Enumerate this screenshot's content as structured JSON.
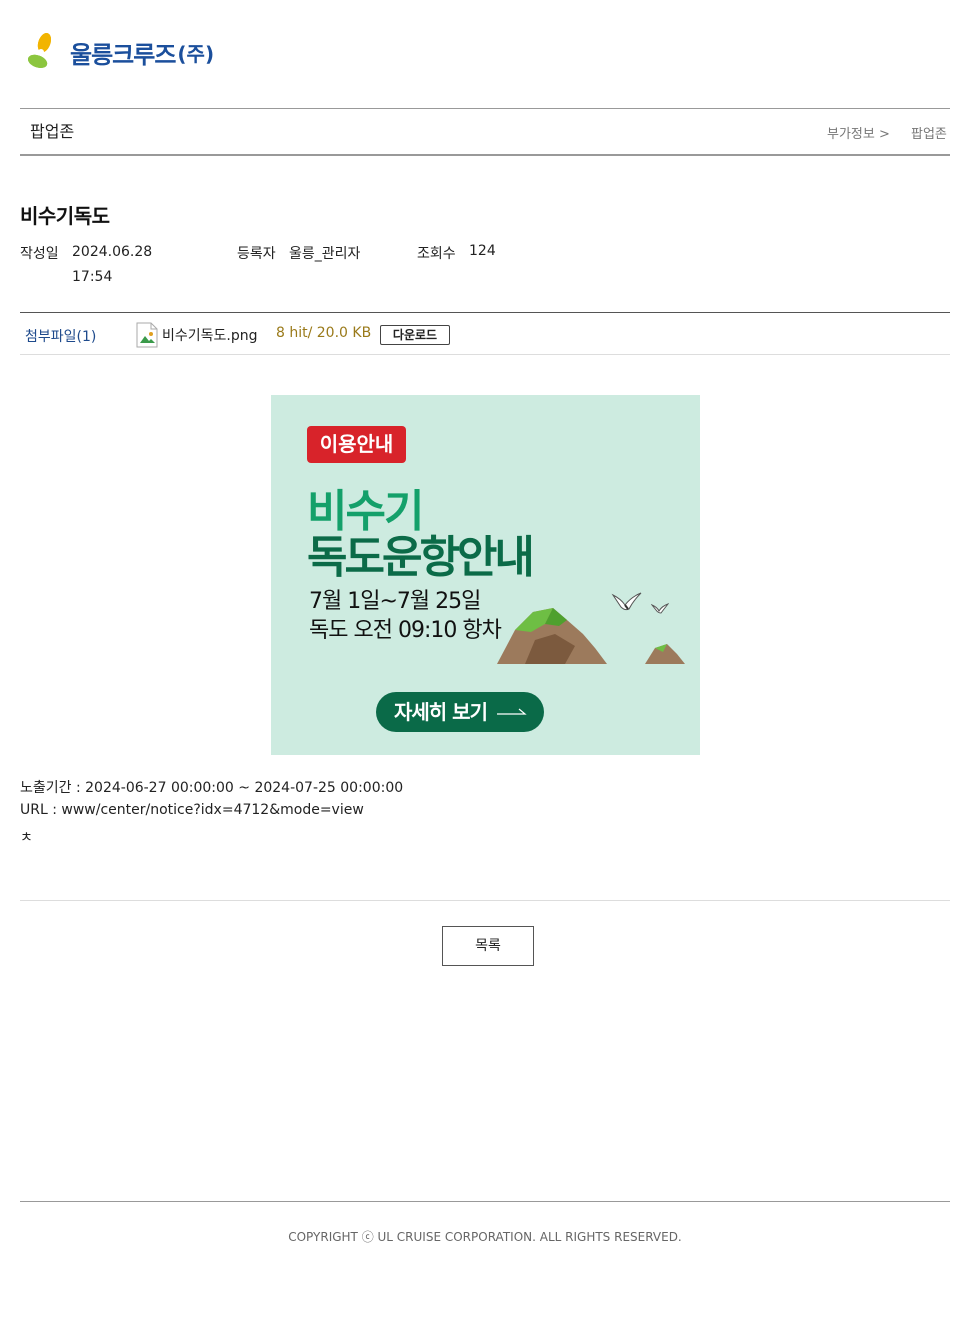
{
  "header": {
    "brand": "울릉크루즈",
    "brand_suffix": "(주)"
  },
  "topbar": {
    "title": "팝업존",
    "breadcrumb": [
      "부가정보 >",
      "팝업존"
    ]
  },
  "post": {
    "title": "비수기독도",
    "meta": {
      "date_label": "작성일",
      "date_value": "2024.06.28",
      "time_value": "17:54",
      "author_label": "등록자",
      "author_value": "울릉_관리자",
      "views_label": "조회수",
      "views_value": "124"
    },
    "attachments": {
      "label": "첨부파일(1)",
      "file_name": "비수기독도.png",
      "file_info": "8 hit/ 20.0 KB",
      "download_label": "다운로드"
    },
    "banner": {
      "badge": "이용안내",
      "headline_1": "비수기",
      "headline_2": "독도운항안내",
      "line_1": "7월 1일~7월 25일",
      "line_2": "독도 오전 09:10 항차",
      "button": "자세히 보기",
      "colors": {
        "bg": "#cdebe0",
        "badge": "#d8232a",
        "green_light": "#14a06a",
        "green_dark": "#0b6b48"
      }
    },
    "info": {
      "period": "노출기간 : 2024-06-27 00:00:00 ~ 2024-07-25 00:00:00",
      "url": "URL : www/center/notice?idx=4712&mode=view",
      "note": "ㅊ"
    }
  },
  "list_button": "목록",
  "footer": {
    "copyright": "COPYRIGHT ⓒ UL CRUISE CORPORATION. ALL RIGHTS RESERVED."
  }
}
